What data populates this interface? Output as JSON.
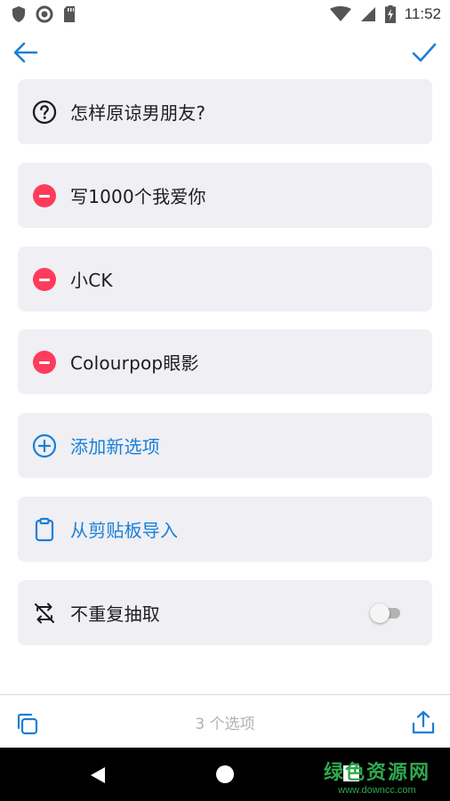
{
  "status_bar": {
    "time": "11:52",
    "left_icons": [
      "shield-icon",
      "circle-icon",
      "sd-card-icon"
    ],
    "right_icons": [
      "wifi-icon",
      "signal-icon",
      "battery-charging-icon"
    ]
  },
  "header": {
    "back_icon": "arrow-left-icon",
    "confirm_icon": "check-icon"
  },
  "question": {
    "icon": "help-circle-icon",
    "text": "怎样原谅男朋友?"
  },
  "options": [
    {
      "label": "写1000个我爱你"
    },
    {
      "label": "小CK"
    },
    {
      "label": "Colourpop眼影"
    }
  ],
  "actions": {
    "add_label": "添加新选项",
    "import_label": "从剪贴板导入"
  },
  "settings": {
    "no_repeat_label": "不重复抽取",
    "no_repeat_enabled": false
  },
  "bottom_bar": {
    "count_text": "3 个选项"
  },
  "watermark": {
    "title": "绿色资源网",
    "url": "www.downcc.com"
  },
  "colors": {
    "accent": "#1a7fd6",
    "remove": "#ff3b5c",
    "card_bg": "#efeff4"
  }
}
